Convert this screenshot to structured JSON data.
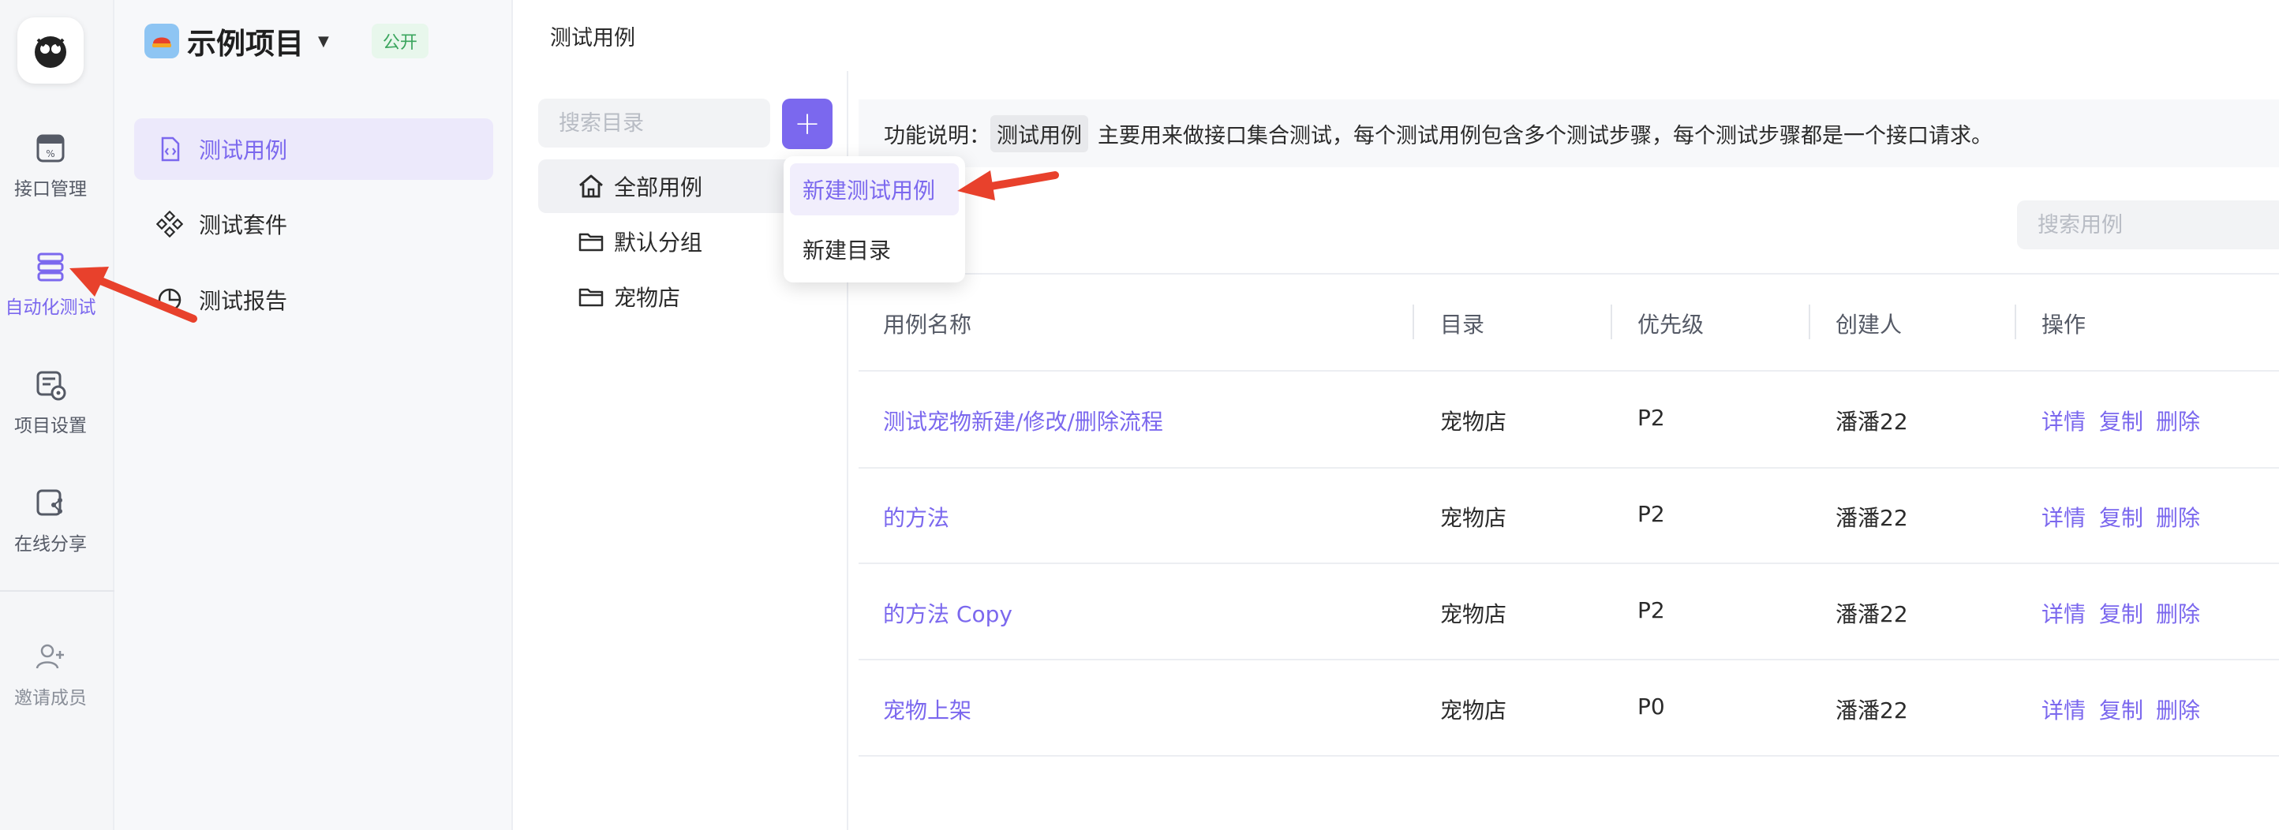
{
  "rail": {
    "items": [
      {
        "label": "接口管理"
      },
      {
        "label": "自动化测试"
      },
      {
        "label": "项目设置"
      },
      {
        "label": "在线分享"
      },
      {
        "label": "邀请成员"
      }
    ]
  },
  "project": {
    "name": "示例项目",
    "visibility": "公开"
  },
  "sidebar": {
    "items": [
      {
        "label": "测试用例"
      },
      {
        "label": "测试套件"
      },
      {
        "label": "测试报告"
      }
    ]
  },
  "breadcrumb": "测试用例",
  "tree": {
    "search_placeholder": "搜索目录",
    "add_label": "+",
    "nodes": [
      {
        "label": "全部用例"
      },
      {
        "label": "默认分组"
      },
      {
        "label": "宠物店"
      }
    ]
  },
  "dropdown": {
    "items": [
      {
        "label": "新建测试用例"
      },
      {
        "label": "新建目录"
      }
    ]
  },
  "note": {
    "prefix": "功能说明：",
    "tag": "测试用例",
    "text": "主要用来做接口集合测试，每个测试用例包含多个测试步骤，每个测试步骤都是一个接口请求。"
  },
  "case_search_placeholder": "搜索用例",
  "table": {
    "headers": [
      "用例名称",
      "目录",
      "优先级",
      "创建人",
      "操作"
    ],
    "rows": [
      {
        "name": "测试宠物新建/修改/删除流程",
        "dir": "宠物店",
        "priority": "P2",
        "creator": "潘潘22"
      },
      {
        "name": "的方法",
        "dir": "宠物店",
        "priority": "P2",
        "creator": "潘潘22"
      },
      {
        "name": "的方法 Copy",
        "dir": "宠物店",
        "priority": "P2",
        "creator": "潘潘22"
      },
      {
        "name": "宠物上架",
        "dir": "宠物店",
        "priority": "P0",
        "creator": "潘潘22"
      }
    ],
    "actions": [
      "详情",
      "复制",
      "删除"
    ]
  },
  "colors": {
    "accent": "#7b68ee",
    "annotation_arrow": "#e8412c",
    "public_badge": "#3aa55d"
  }
}
